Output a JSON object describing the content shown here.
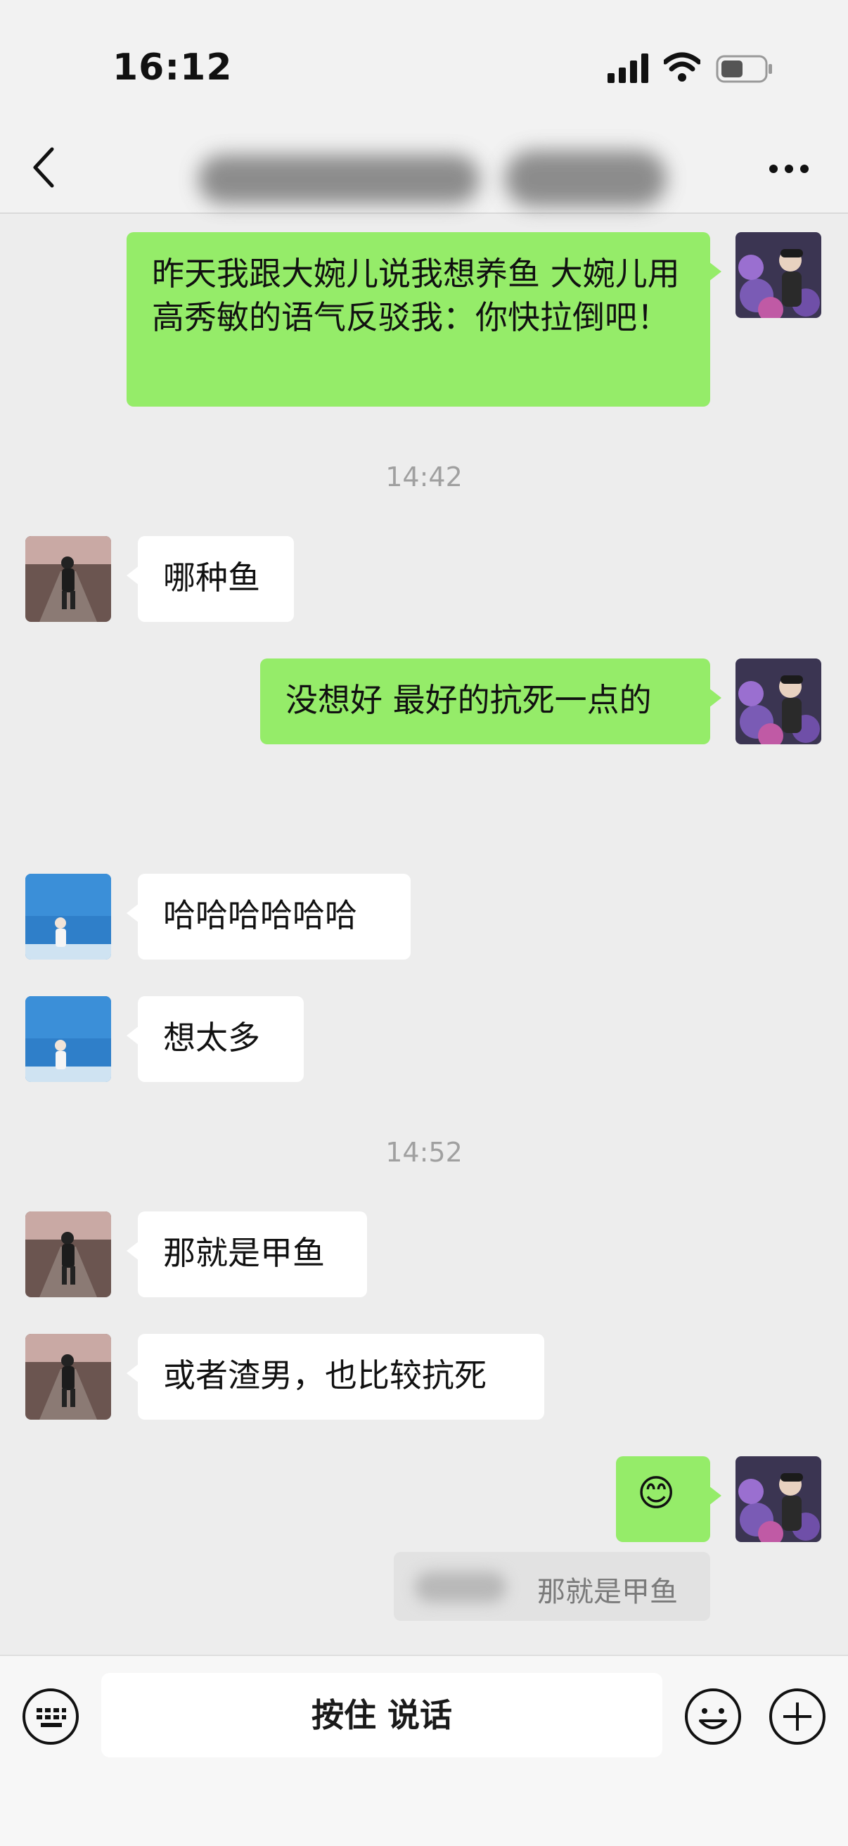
{
  "status_bar": {
    "time": "16:12"
  },
  "nav": {
    "back_icon": "chevron-left-icon",
    "more_icon": "more-dots-icon"
  },
  "messages": [
    {
      "side": "me",
      "text": "昨天我跟大婉儿说我想养鱼 大婉儿用高秀敏的语气反驳我：你快拉倒吧！"
    },
    {
      "side": "timestamp",
      "text": "14:42"
    },
    {
      "side": "other",
      "text": "哪种鱼"
    },
    {
      "side": "me",
      "text": "没想好 最好的抗死一点的"
    },
    {
      "side": "other",
      "text": "哈哈哈哈哈哈"
    },
    {
      "side": "other",
      "text": "想太多"
    },
    {
      "side": "timestamp",
      "text": "14:52"
    },
    {
      "side": "other",
      "text": "那就是甲鱼"
    },
    {
      "side": "other",
      "text": "或者渣男，也比较抗死"
    },
    {
      "side": "me",
      "text": "😊"
    }
  ],
  "quote": {
    "text": "那就是甲鱼"
  },
  "input_bar": {
    "voice_label": "按住 说话",
    "keyboard_icon": "keyboard-icon",
    "emoji_icon": "emoji-face-icon",
    "plus_icon": "plus-circle-icon"
  },
  "colors": {
    "my_bubble": "#95ec69",
    "other_bubble": "#ffffff",
    "background": "#ededed"
  }
}
